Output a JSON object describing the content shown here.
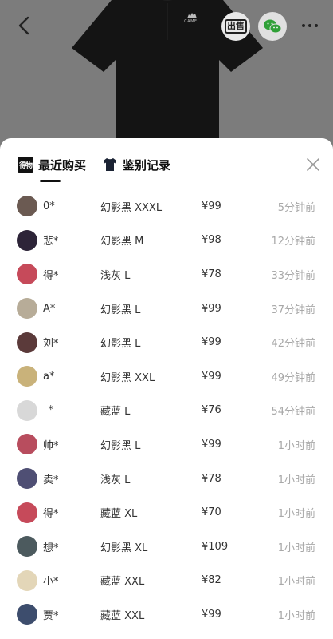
{
  "product": {
    "brand_mark": "CAMEL"
  },
  "topbar": {
    "sell_label": "出售"
  },
  "sheet": {
    "tabs": [
      {
        "label": "最近购买",
        "logo_text": "得物"
      },
      {
        "label": "鉴别记录"
      }
    ]
  },
  "records": [
    {
      "name": "0*",
      "spec": "幻影黑 XXXL",
      "price": "¥99",
      "time": "5分钟前",
      "avatar_color": "#6b5a52"
    },
    {
      "name": "悲*",
      "spec": "幻影黑 M",
      "price": "¥98",
      "time": "12分钟前",
      "avatar_color": "#2d2438"
    },
    {
      "name": "得*",
      "spec": "浅灰 L",
      "price": "¥78",
      "time": "33分钟前",
      "avatar_color": "#c64a5a"
    },
    {
      "name": "A*",
      "spec": "幻影黑 L",
      "price": "¥99",
      "time": "37分钟前",
      "avatar_color": "#b7ac98"
    },
    {
      "name": "刘*",
      "spec": "幻影黑 L",
      "price": "¥99",
      "time": "42分钟前",
      "avatar_color": "#5b3a3a"
    },
    {
      "name": "a*",
      "spec": "幻影黑 XXL",
      "price": "¥99",
      "time": "49分钟前",
      "avatar_color": "#c9b27a"
    },
    {
      "name": "_*",
      "spec": "藏蓝 L",
      "price": "¥76",
      "time": "54分钟前",
      "avatar_color": "#d8d8d8"
    },
    {
      "name": "帅*",
      "spec": "幻影黑 L",
      "price": "¥99",
      "time": "1小时前",
      "avatar_color": "#b84d5e"
    },
    {
      "name": "卖*",
      "spec": "浅灰 L",
      "price": "¥78",
      "time": "1小时前",
      "avatar_color": "#4f4f74"
    },
    {
      "name": "得*",
      "spec": "藏蓝 XL",
      "price": "¥70",
      "time": "1小时前",
      "avatar_color": "#c64a5a"
    },
    {
      "name": "想*",
      "spec": "幻影黑 XL",
      "price": "¥109",
      "time": "1小时前",
      "avatar_color": "#4c5a5e"
    },
    {
      "name": "小*",
      "spec": "藏蓝 XXL",
      "price": "¥82",
      "time": "1小时前",
      "avatar_color": "#e3d6b8"
    },
    {
      "name": "贾*",
      "spec": "藏蓝 XXL",
      "price": "¥99",
      "time": "1小时前",
      "avatar_color": "#3d4d6d"
    }
  ]
}
